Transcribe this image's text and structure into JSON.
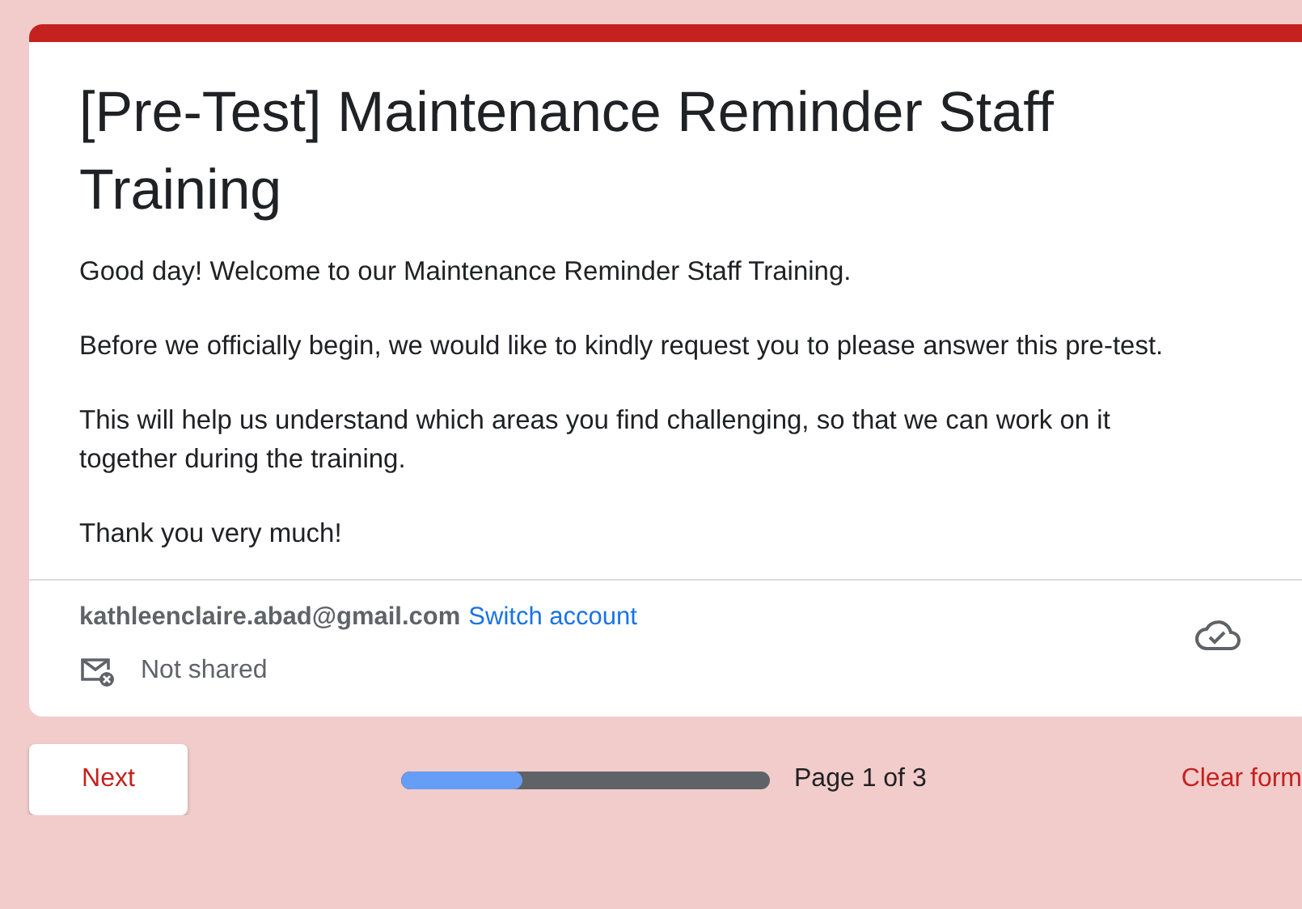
{
  "form": {
    "title": "[Pre-Test] Maintenance Reminder Staff Training",
    "description": [
      "Good day! Welcome to our Maintenance Reminder Staff Training.",
      "Before we officially begin, we would like to kindly request you to please answer this pre-test.",
      "This will help us understand which areas you find challenging, so that we can work on it together during the training.",
      "Thank you very much!"
    ],
    "account": {
      "email": "kathleenclaire.abad@gmail.com",
      "switch_link": "Switch account",
      "sharing": "Not shared"
    }
  },
  "footer": {
    "next_button": "Next",
    "progress": {
      "level": 0.33
    },
    "page_label": "Page 1 of 3",
    "clear_button": "Clear form"
  }
}
